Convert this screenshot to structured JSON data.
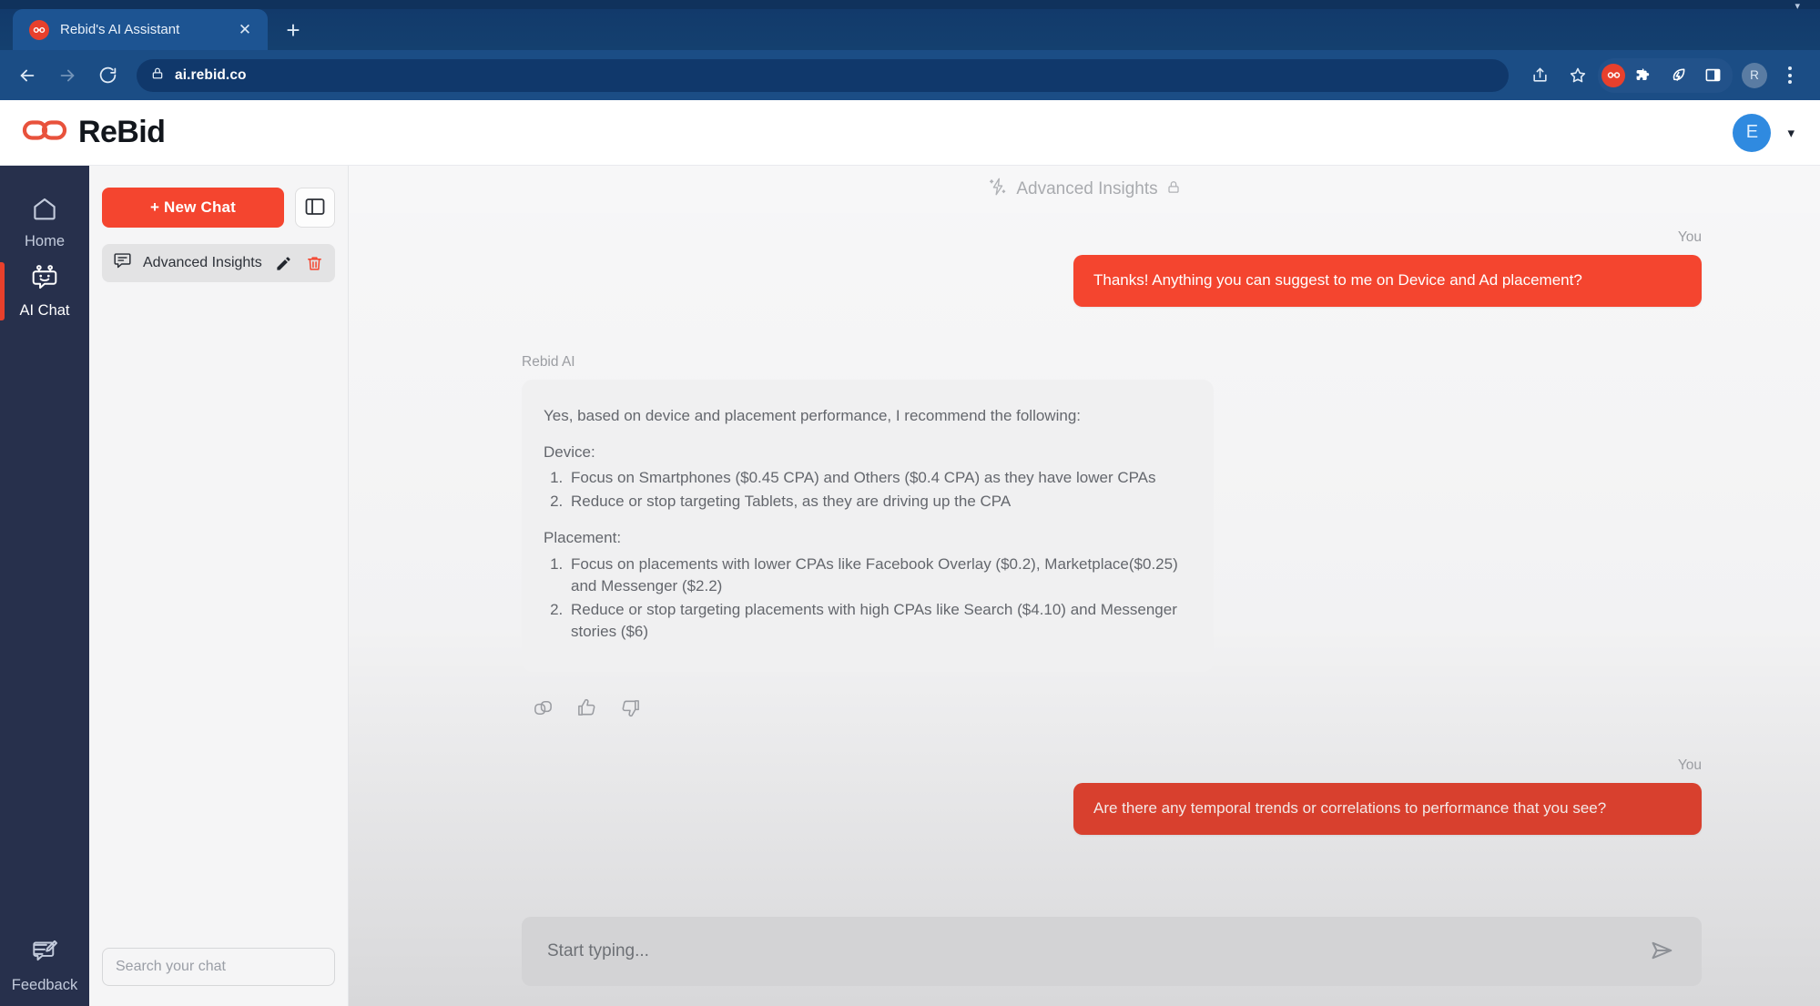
{
  "browser": {
    "tab": {
      "title": "Rebid's AI Assistant",
      "favicon_icon": "rebid-link-favicon",
      "close_icon": "close-icon"
    },
    "new_tab_label": "+",
    "nav": {
      "back_icon": "back-arrow-icon",
      "forward_icon": "forward-arrow-icon",
      "reload_icon": "reload-icon"
    },
    "omnibox": {
      "lock_icon": "lock-icon",
      "url": "ai.rebid.co"
    },
    "toolbar_right": {
      "share_icon": "share-icon",
      "bookmark_icon": "star-icon",
      "rebid_extension_icon": "rebid-link-extension-icon",
      "extensions_icon": "puzzle-piece-icon",
      "speed_icon": "leaf-bolt-icon",
      "side_panel_icon": "side-panel-icon",
      "profile_initial": "R",
      "menu_icon": "kebab-menu-icon"
    },
    "window_chevron_icon": "chevron-down-icon"
  },
  "app_header": {
    "logo_icon": "rebid-chain-link-logo",
    "brand": "ReBid",
    "user_initial": "E",
    "user_menu_icon": "chevron-down-icon"
  },
  "rail": {
    "items": [
      {
        "label": "Home",
        "icon": "home-icon",
        "active": false
      },
      {
        "label": "AI Chat",
        "icon": "robot-icon",
        "active": true
      }
    ],
    "bottom_item": {
      "label": "Feedback",
      "icon": "feedback-pencil-icon"
    }
  },
  "chat_panel": {
    "new_chat_label": "+ New Chat",
    "panel_toggle_icon": "side-panel-toggle-icon",
    "chats": [
      {
        "label": "Advanced Insights",
        "icon": "chat-bubble-icon",
        "edit_icon": "pencil-icon",
        "delete_icon": "trash-icon",
        "selected": true
      }
    ],
    "search_placeholder": "Search your chat",
    "search_value": ""
  },
  "conversation": {
    "header": {
      "sparkle_icon": "sparkle-bolt-icon",
      "title": "Advanced Insights",
      "lock_icon": "lock-icon"
    },
    "user_label": "You",
    "ai_label": "Rebid AI",
    "messages": [
      {
        "role": "user",
        "label": "You",
        "text": "Thanks! Anything you can suggest to me on Device and Ad placement?"
      },
      {
        "role": "ai",
        "label": "Rebid AI",
        "intro": "Yes, based on device and placement performance, I recommend the following:",
        "sections": [
          {
            "heading": "Device:",
            "items": [
              "Focus on Smartphones ($0.45 CPA) and Others ($0.4 CPA) as they have lower CPAs",
              "Reduce or stop targeting Tablets, as they are driving up the CPA"
            ]
          },
          {
            "heading": "Placement:",
            "items": [
              "Focus on placements with lower CPAs like Facebook Overlay ($0.2), Marketplace($0.25) and Messenger ($2.2)",
              "Reduce or stop targeting placements with high CPAs like Search ($4.10) and Messenger stories ($6)"
            ]
          }
        ],
        "actions": [
          {
            "name": "copy-icon"
          },
          {
            "name": "thumbs-up-icon"
          },
          {
            "name": "thumbs-down-icon"
          }
        ]
      },
      {
        "role": "user",
        "label": "You",
        "text": "Are there any temporal trends or correlations to performance that you see?"
      }
    ],
    "composer": {
      "placeholder": "Start typing...",
      "value": "",
      "send_icon": "send-paper-plane-icon"
    }
  },
  "colors": {
    "brand_red": "#f4452f",
    "rail_navy": "#27304c",
    "chrome_blue": "#1b4d85",
    "avatar_blue": "#2f8ae0"
  }
}
